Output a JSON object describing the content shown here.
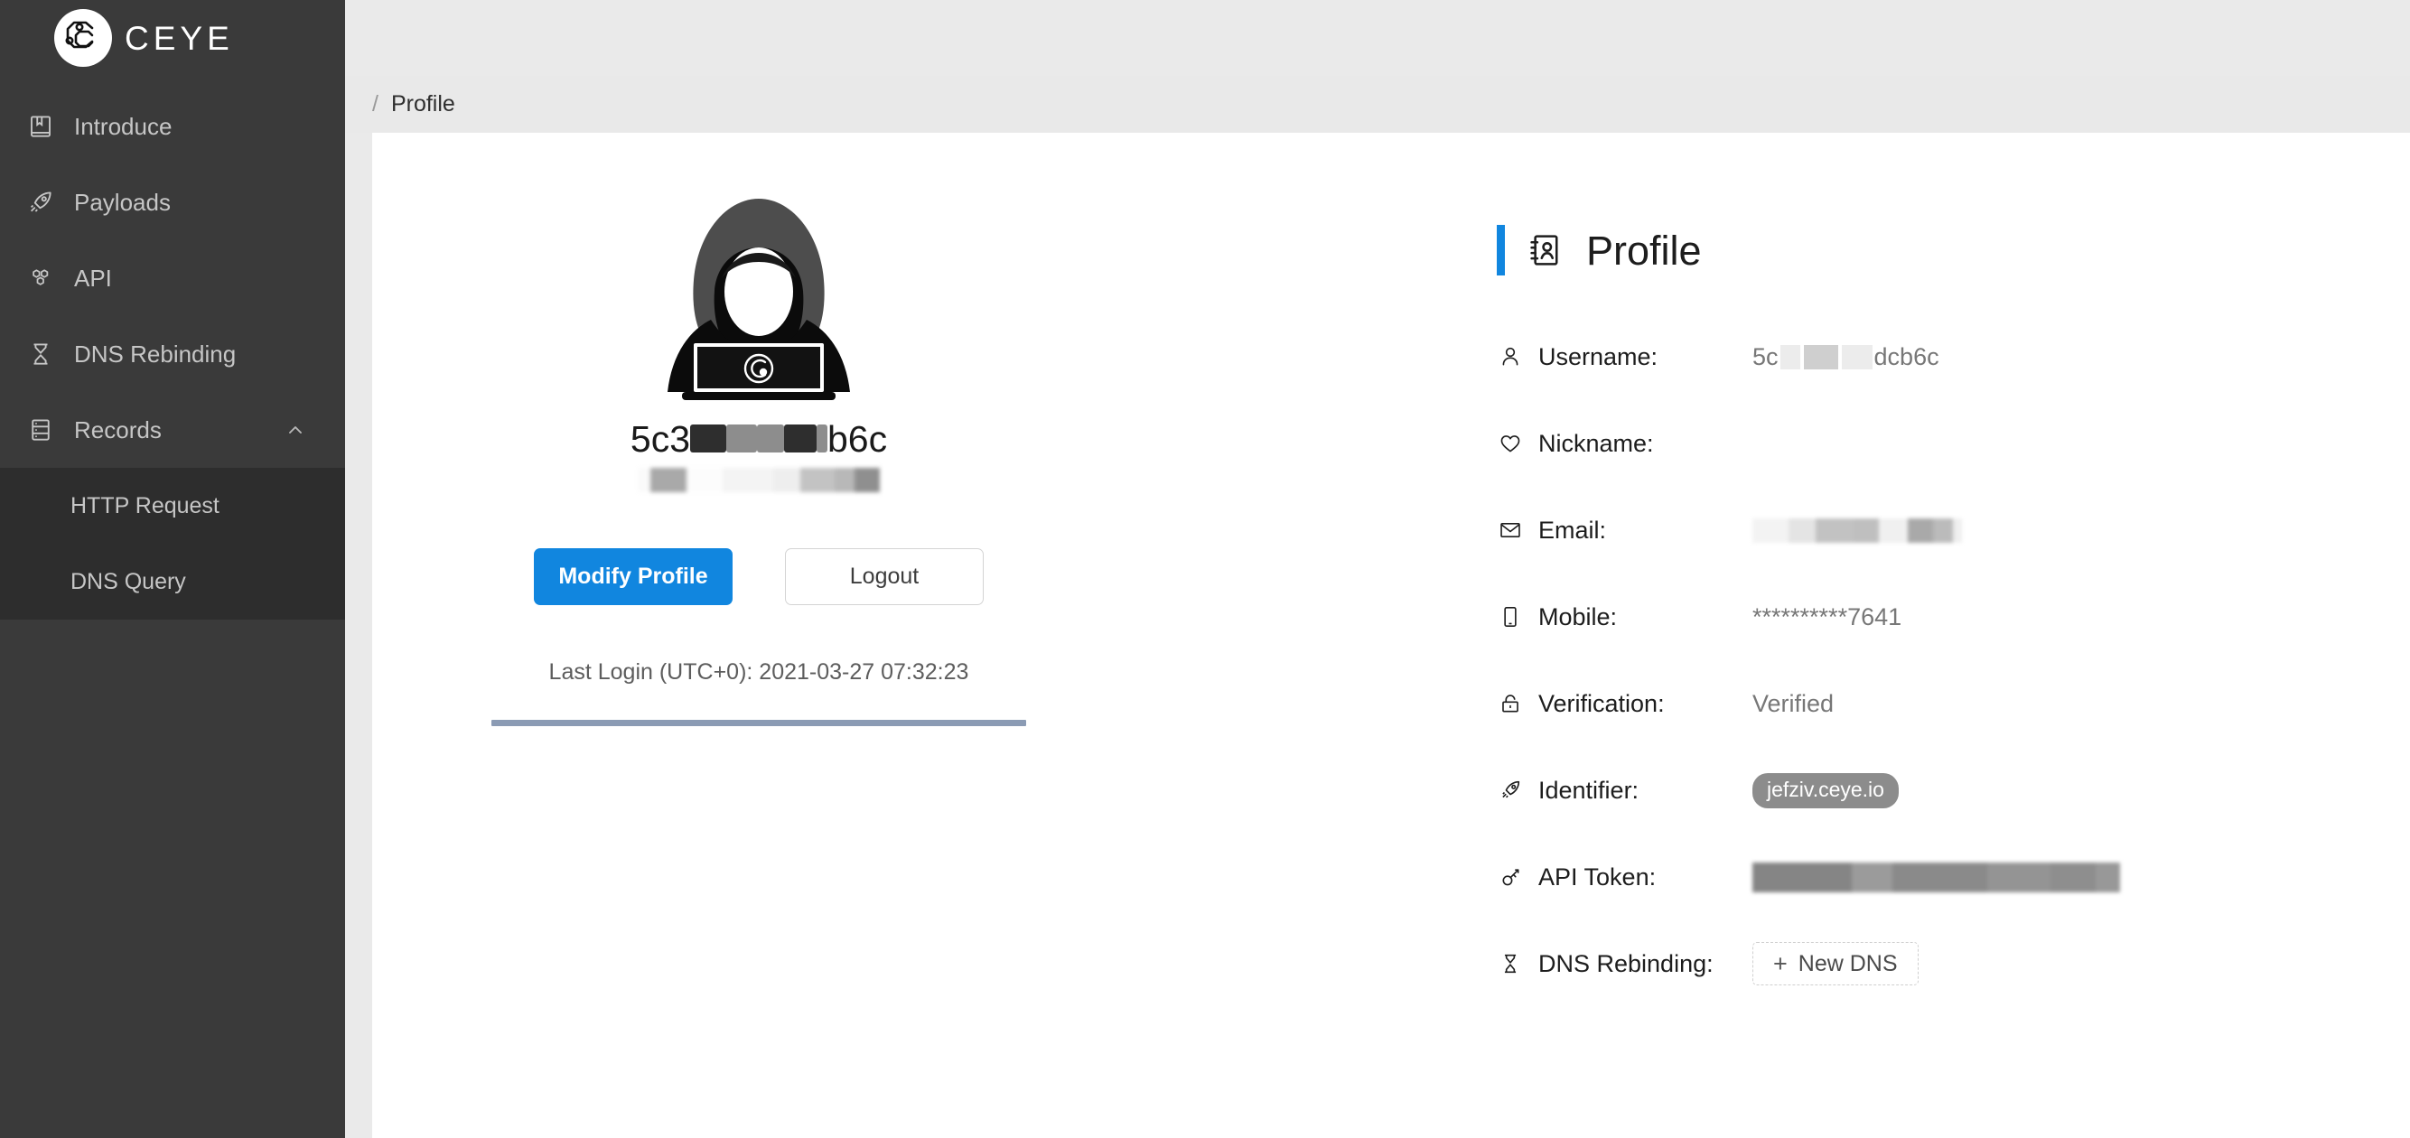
{
  "brand": {
    "name": "CEYE",
    "logo_icon": "ceye-circuit-logo-icon"
  },
  "sidebar": {
    "items": [
      {
        "label": "Introduce",
        "icon": "book-icon"
      },
      {
        "label": "Payloads",
        "icon": "rocket-icon"
      },
      {
        "label": "API",
        "icon": "honeycomb-icon"
      },
      {
        "label": "DNS Rebinding",
        "icon": "hourglass-icon"
      },
      {
        "label": "Records",
        "icon": "database-icon",
        "expanded": true,
        "chevron": "chevron-up-icon"
      }
    ],
    "records_submenu": [
      {
        "label": "HTTP Request"
      },
      {
        "label": "DNS Query"
      }
    ]
  },
  "breadcrumb": {
    "separator": "/",
    "current": "Profile"
  },
  "avatar_card": {
    "avatar_icon": "hooded-hacker-with-laptop-icon",
    "username_prefix": "5c3",
    "username_suffix": "b6c",
    "username_redacted": true,
    "buttons": {
      "modify": "Modify Profile",
      "logout": "Logout"
    },
    "last_login": "Last Login (UTC+0): 2021-03-27 07:32:23"
  },
  "profile": {
    "title": "Profile",
    "title_icon": "contact-card-icon",
    "accent_color": "#1186df",
    "rows": [
      {
        "label": "Username:",
        "icon": "user-icon",
        "type": "masked-text",
        "value_prefix": "5c",
        "value_suffix": "dcb6c"
      },
      {
        "label": "Nickname:",
        "icon": "heart-icon",
        "type": "text",
        "value": ""
      },
      {
        "label": "Email:",
        "icon": "envelope-icon",
        "type": "blurred",
        "value": ""
      },
      {
        "label": "Mobile:",
        "icon": "mobile-icon",
        "type": "text",
        "value": "**********7641"
      },
      {
        "label": "Verification:",
        "icon": "lock-icon",
        "type": "text",
        "value": "Verified"
      },
      {
        "label": "Identifier:",
        "icon": "rocket-icon",
        "type": "pill",
        "value": "jefziv.ceye.io"
      },
      {
        "label": "API Token:",
        "icon": "key-icon",
        "type": "blurred",
        "value": ""
      },
      {
        "label": "DNS Rebinding:",
        "icon": "hourglass-icon",
        "type": "button",
        "value": "New DNS",
        "button_plus": "+"
      }
    ]
  },
  "colors": {
    "sidebar_bg": "#3a3a3a",
    "submenu_bg": "#2d2d2d",
    "breadcrumb_bg": "#e9e9e9",
    "content_bg": "#ffffff",
    "primary": "#1186df",
    "divider": "#8b9bb4"
  }
}
